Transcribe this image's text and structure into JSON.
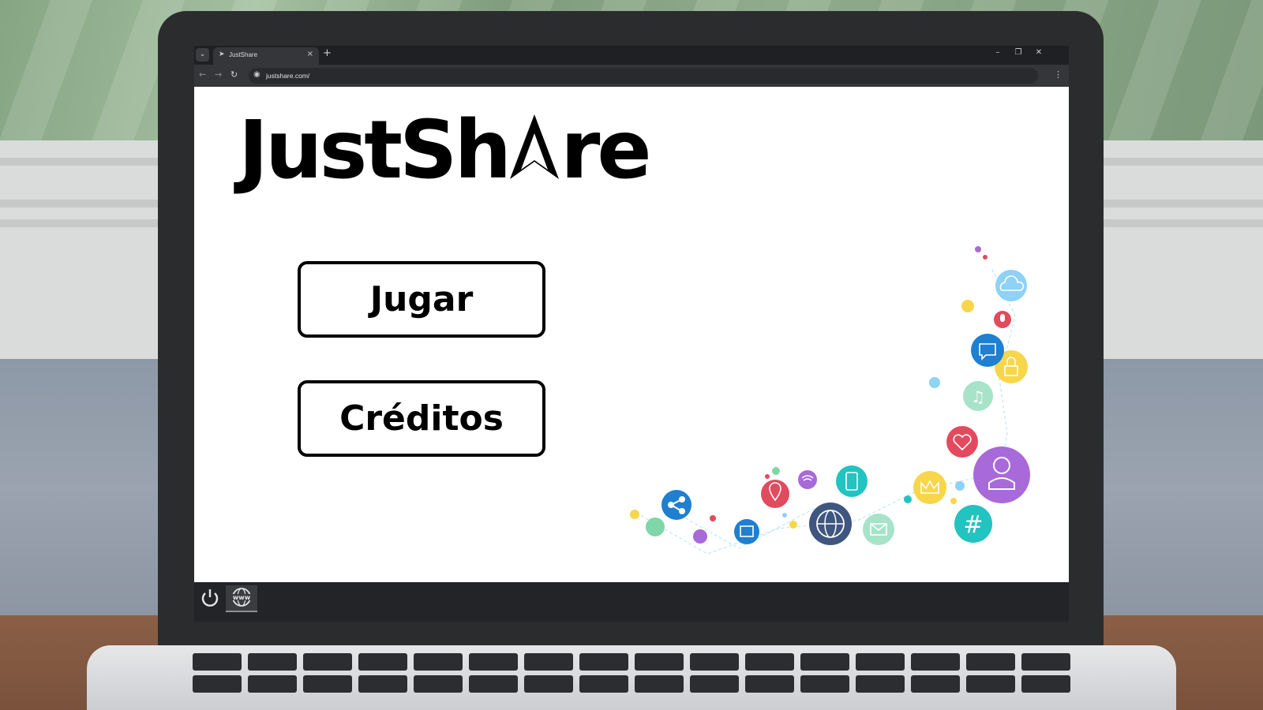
{
  "browser": {
    "tab_title": "JustShare",
    "url": "justshare.com/",
    "tab_menu_icon": "chevron-down",
    "close_tab_icon": "close",
    "new_tab_icon": "plus"
  },
  "game": {
    "logo_text_1": "JustSh",
    "logo_text_2": "re",
    "buttons": {
      "play": "Jugar",
      "credits": "Créditos"
    }
  },
  "taskbar": {
    "power_icon": "power-icon",
    "www_icon": "www-icon"
  },
  "colors": {
    "icon_blue": "#1f7fd0",
    "icon_purple": "#a86ad8",
    "icon_red": "#e24a5e",
    "icon_teal": "#22c3c0",
    "icon_yellow": "#f7d64a",
    "icon_green": "#7fd6a7",
    "icon_navy": "#3f5680",
    "icon_light_blue": "#8ed2f5"
  }
}
